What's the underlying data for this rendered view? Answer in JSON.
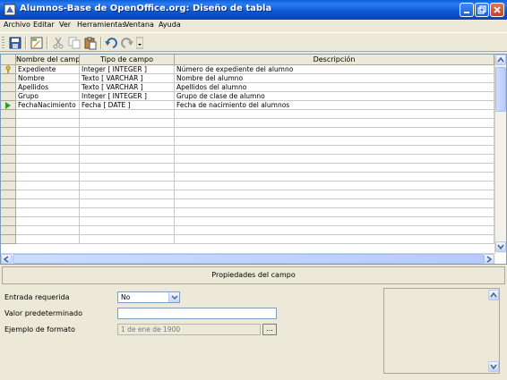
{
  "window": {
    "title": "Alumnos-Base de OpenOffice.org: Diseño de tabla"
  },
  "menu": [
    "Archivo",
    "Editar",
    "Ver",
    "Herramientas",
    "Ventana",
    "Ayuda"
  ],
  "toolbar": {
    "icons": [
      "save-icon",
      "edit-icon",
      "cut-icon",
      "copy-icon",
      "paste-icon",
      "undo-icon",
      "redo-icon",
      "dropdown-arrow-icon"
    ]
  },
  "table": {
    "headers": [
      "Nombre del campo",
      "Tipo de campo",
      "Descripción"
    ],
    "rows": [
      {
        "name": "Expediente",
        "type": "Integer [ INTEGER ]",
        "desc": "Número de expediente del alumno",
        "marker": "primary-key"
      },
      {
        "name": "Nombre",
        "type": "Texto [ VARCHAR ]",
        "desc": "Nombre del alumno",
        "marker": ""
      },
      {
        "name": "Apellidos",
        "type": "Texto [ VARCHAR ]",
        "desc": "Apellidos del alumno",
        "marker": ""
      },
      {
        "name": "Grupo",
        "type": "Integer [ INTEGER ]",
        "desc": "Grupo de clase de alumno",
        "marker": ""
      },
      {
        "name": "FechaNacimiento",
        "type": "Fecha [ DATE ]",
        "desc": "Fecha de nacimiento del alumnos",
        "marker": "current"
      }
    ],
    "empty_rows": 15
  },
  "properties": {
    "header": "Propiedades del campo",
    "entrada_label": "Entrada requerida",
    "entrada_value": "No",
    "valor_label": "Valor predeterminado",
    "valor_value": "",
    "formato_label": "Ejemplo de formato",
    "formato_value": "1 de ene de 1900",
    "formato_button": "..."
  }
}
